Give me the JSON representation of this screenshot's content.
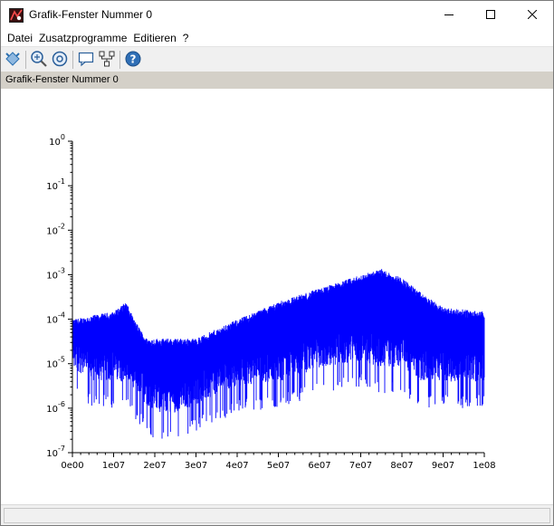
{
  "window": {
    "title": "Grafik-Fenster Nummer 0",
    "minimize_icon": "minimize-icon",
    "maximize_icon": "maximize-icon",
    "close_icon": "close-icon"
  },
  "menubar": {
    "items": [
      "Datei",
      "Zusatzprogramme",
      "Editieren",
      "?"
    ]
  },
  "toolbar": {
    "icons": [
      "rotate-icon",
      "zoom-icon",
      "unzoom-icon",
      "datatip-icon",
      "tree-icon",
      "help-icon"
    ]
  },
  "infobar": {
    "text": "Grafik-Fenster Nummer 0"
  },
  "colors": {
    "series": "#0000ff",
    "axis": "#000000",
    "infobar": "#d4d0c8"
  },
  "chart_data": {
    "type": "line",
    "title": "",
    "xlabel": "",
    "ylabel": "",
    "xscale": "linear",
    "yscale": "log",
    "xlim": [
      0,
      100000000
    ],
    "ylim": [
      1e-07,
      1
    ],
    "grid": false,
    "x_ticks": [
      "0e00",
      "1e07",
      "2e07",
      "3e07",
      "4e07",
      "5e07",
      "6e07",
      "7e07",
      "8e07",
      "9e07",
      "1e08"
    ],
    "y_ticks": [
      {
        "base": "10",
        "exp": "0"
      },
      {
        "base": "10",
        "exp": "-1"
      },
      {
        "base": "10",
        "exp": "-2"
      },
      {
        "base": "10",
        "exp": "-3"
      },
      {
        "base": "10",
        "exp": "-4"
      },
      {
        "base": "10",
        "exp": "-5"
      },
      {
        "base": "10",
        "exp": "-6"
      },
      {
        "base": "10",
        "exp": "-7"
      }
    ],
    "series": [
      {
        "x": [
          0,
          5000000,
          10000000,
          13000000,
          15000000,
          18000000,
          20000000,
          25000000,
          30000000,
          40000000,
          50000000,
          60000000,
          70000000,
          75000000,
          80000000,
          85000000,
          90000000,
          100000000
        ],
        "upper": [
          8e-05,
          0.0001,
          0.00012,
          0.0002,
          8e-05,
          3e-05,
          3e-05,
          3e-05,
          3e-05,
          8e-05,
          0.0002,
          0.0004,
          0.0008,
          0.0011,
          0.0007,
          0.0003,
          0.00015,
          0.00012
        ],
        "lower": [
          2e-06,
          1e-06,
          1e-06,
          1e-06,
          5e-07,
          3e-07,
          2e-07,
          2e-07,
          3e-07,
          8e-07,
          1e-06,
          2e-06,
          3e-06,
          2e-06,
          2e-06,
          1e-06,
          1e-06,
          1e-06
        ]
      }
    ]
  }
}
